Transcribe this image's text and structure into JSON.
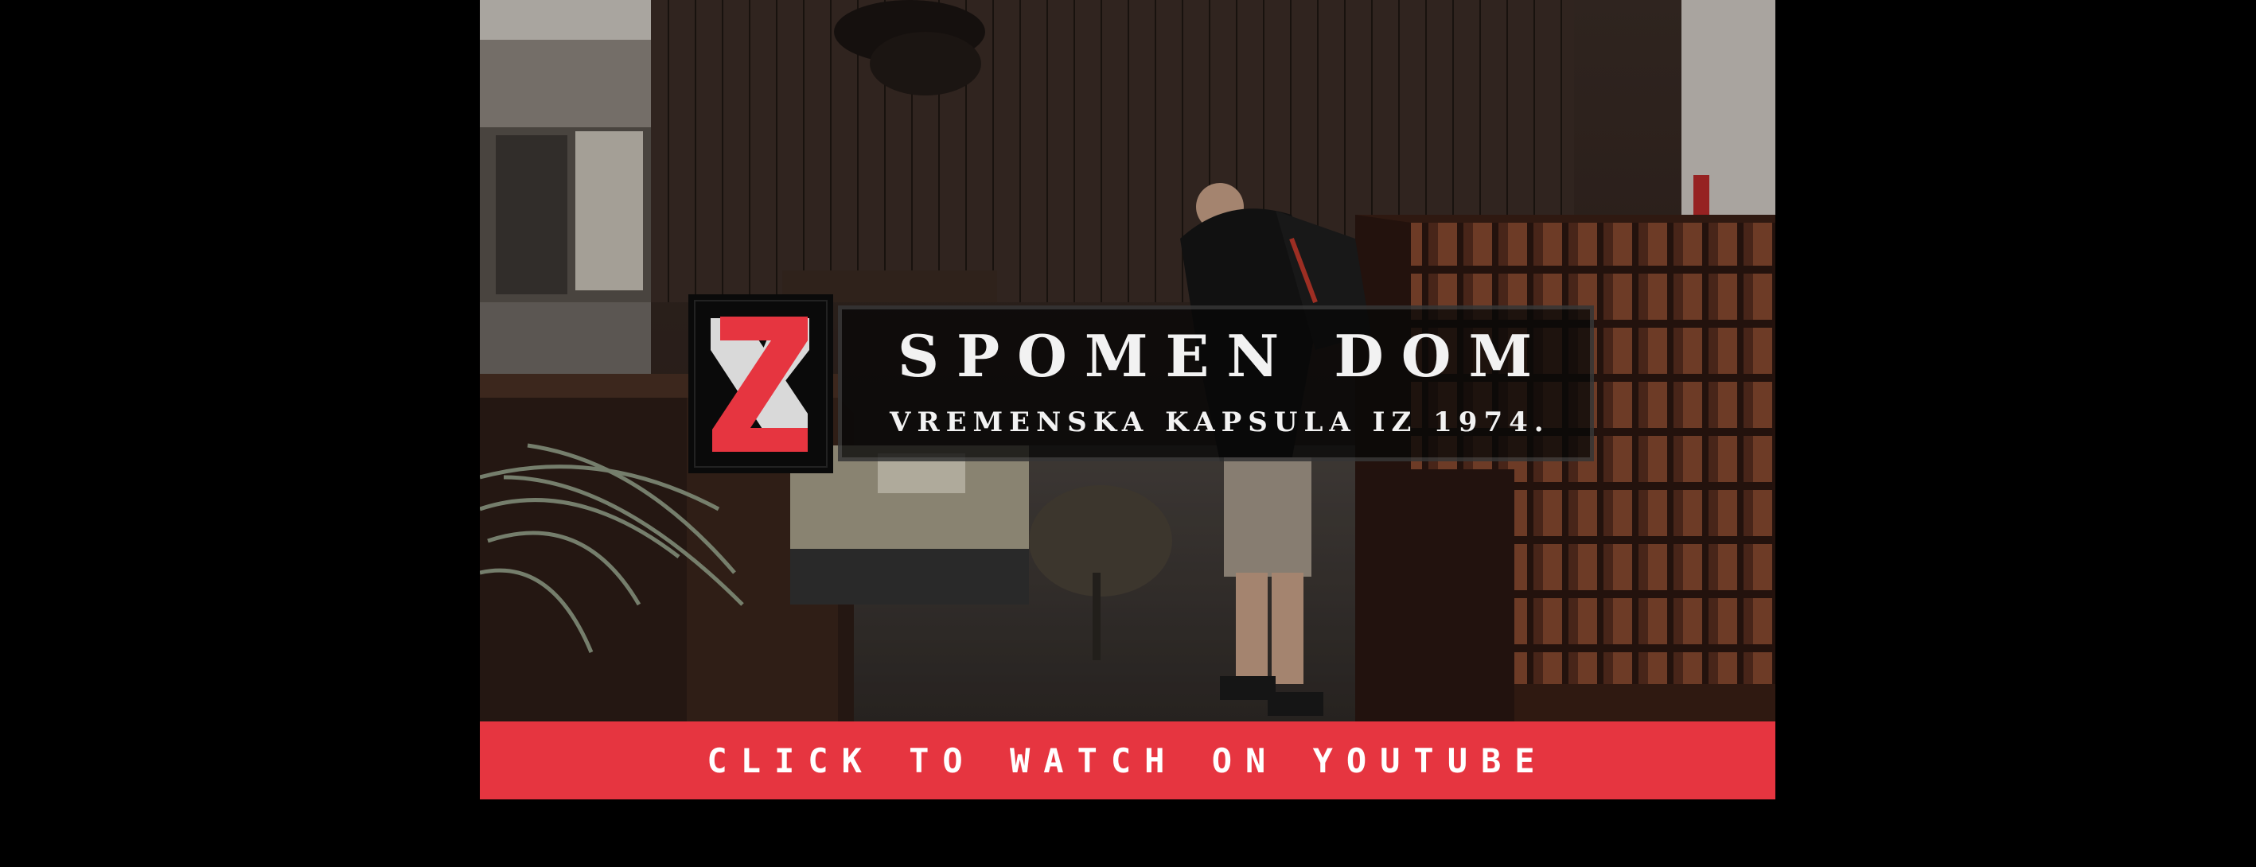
{
  "video": {
    "title": "SPOMEN DOM",
    "subtitle": "VREMENSKA KAPSULA IZ 1974.",
    "logo": "red-white-z-logo",
    "accent_color": "#e63540"
  },
  "cta": {
    "label": "CLICK TO WATCH ON YOUTUBE",
    "color": "#e63540"
  }
}
